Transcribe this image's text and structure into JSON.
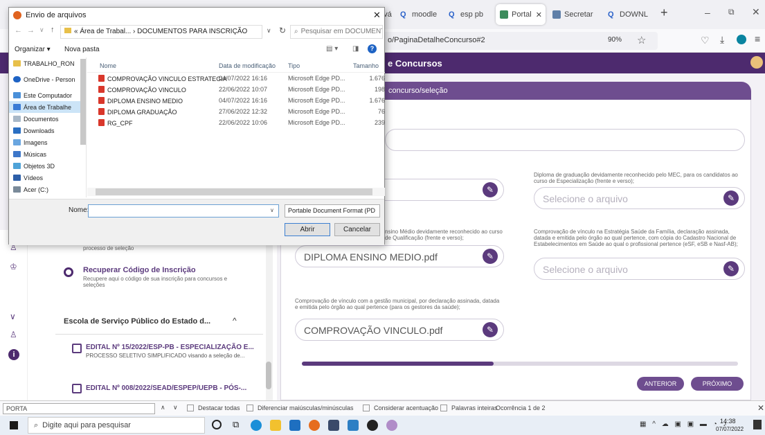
{
  "browser": {
    "tabs": [
      {
        "label": "URL invá"
      },
      {
        "label": "moodle"
      },
      {
        "label": "esp pb"
      },
      {
        "label": "Portal"
      },
      {
        "label": "Secretar"
      },
      {
        "label": "DOWNL"
      }
    ],
    "url": "o/PaginaDetalheConcurso#2",
    "zoom": "90%"
  },
  "page": {
    "header_title": "e Concursos",
    "purple_tab": "concurso/seleção",
    "fields": [
      {
        "label": "Diploma de graduação devidamente reconhecido pelo MEC, para os candidatos ao curso de Especialização (frente e verso);",
        "value": "",
        "placeholder": "Selecione o arquivo"
      },
      {
        "label": "nsino Médio devidamente reconhecido ao curso de Qualificação (frente e verso);",
        "value": "DIPLOMA ENSINO MEDIO.pdf",
        "placeholder": ""
      },
      {
        "label": "Comprovação de vínculo na Estratégia Saúde da Família, declaração assinada, datada e emitida pelo órgão ao qual pertence, com cópia do Cadastro Nacional de Estabelecimentos em Saúde ao qual o profissional pertence (eSF, eSB e Nasf-AB);",
        "value": "",
        "placeholder": "Selecione o arquivo"
      },
      {
        "label": "Comprovação de vínculo com a gestão municipal, por declaração assinada, datada e emitida pelo órgão ao qual pertence (para os gestores da saúde);",
        "value": "COMPROVAÇÃO VINCULO.pdf",
        "placeholder": ""
      }
    ],
    "btn_prev": "ANTERIOR",
    "btn_next": "PRÓXIMO",
    "sidebar": {
      "item1_sub": "processo de seleção",
      "recover_title": "Recuperar Código de Inscrição",
      "recover_desc": "Recupere aqui o código de sua inscrição para concursos e seleções",
      "school": "Escola de Serviço Público do Estado d...",
      "edital1_title": "EDITAL Nº 15/2022/ESP-PB - ESPECIALIZAÇÃO E...",
      "edital1_desc": "PROCESSO SELETIVO SIMPLIFICADO visando a seleção de...",
      "edital2_title": "EDITAL Nº 008/2022/SEAD/ESPEP/UEPB - PÓS-..."
    }
  },
  "dialog": {
    "title": "Envio de arquivos",
    "path": "« Área de Trabal... › DOCUMENTOS PARA INSCRIÇÃO",
    "search_placeholder": "Pesquisar em DOCUMENTOS...",
    "organize": "Organizar ▾",
    "new_folder": "Nova pasta",
    "tree": [
      {
        "label": "TRABALHO_RON",
        "icon": "folder"
      },
      {
        "label": "OneDrive - Person",
        "icon": "cloud"
      },
      {
        "label": "Este Computador",
        "icon": "computer"
      },
      {
        "label": "Área de Trabalhe",
        "icon": "desktop"
      },
      {
        "label": "Documentos",
        "icon": "documents"
      },
      {
        "label": "Downloads",
        "icon": "downloads"
      },
      {
        "label": "Imagens",
        "icon": "images"
      },
      {
        "label": "Músicas",
        "icon": "music"
      },
      {
        "label": "Objetos 3D",
        "icon": "3d"
      },
      {
        "label": "Vídeos",
        "icon": "videos"
      },
      {
        "label": "Acer (C:)",
        "icon": "drive"
      }
    ],
    "columns": [
      "Nome",
      "Data de modificação",
      "Tipo",
      "Tamanho"
    ],
    "files": [
      {
        "name": "COMPROVAÇÃO VINCULO ESTRATEGIA",
        "date": "04/07/2022 16:16",
        "type": "Microsoft Edge PD...",
        "size": "1.676"
      },
      {
        "name": "COMPROVAÇÃO VINCULO",
        "date": "22/06/2022 10:07",
        "type": "Microsoft Edge PD...",
        "size": "198"
      },
      {
        "name": "DIPLOMA ENSINO MEDIO",
        "date": "04/07/2022 16:16",
        "type": "Microsoft Edge PD...",
        "size": "1.676"
      },
      {
        "name": "DIPLOMA GRADUAÇÃO",
        "date": "27/06/2022 12:32",
        "type": "Microsoft Edge PD...",
        "size": "76"
      },
      {
        "name": "RG_CPF",
        "date": "22/06/2022 10:06",
        "type": "Microsoft Edge PD...",
        "size": "239"
      }
    ],
    "name_label": "Nome:",
    "name_value": "",
    "filter": "Portable Document Format (PD",
    "open": "Abrir",
    "cancel": "Cancelar"
  },
  "find_bar": {
    "query": "PORTA",
    "highlight_all": "Destacar todas",
    "match_case": "Diferenciar maiúsculas/minúsculas",
    "match_accents": "Considerar acentuação",
    "whole_words": "Palavras inteiras",
    "result": "Ocorrência 1 de 2"
  },
  "taskbar": {
    "search_placeholder": "Digite aqui para pesquisar",
    "time": "14:38",
    "date": "07/07/2022"
  },
  "colors": {
    "brand_purple": "#4d2a6e",
    "accent_purple": "#6e4d8f",
    "selection_blue": "#cce4f7"
  }
}
